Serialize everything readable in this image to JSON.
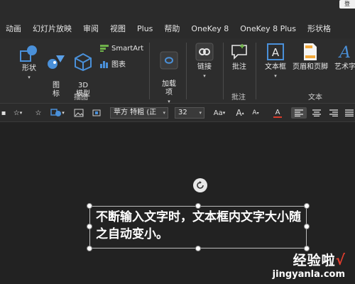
{
  "topbar": {
    "signin_label": "登"
  },
  "menu": {
    "tabs": [
      "动画",
      "幻灯片放映",
      "审阅",
      "视图",
      "Plus",
      "帮助",
      "OneKey 8",
      "OneKey 8 Plus",
      "形状格"
    ]
  },
  "ribbon": {
    "illustrations": {
      "shapes": "形状",
      "icons": "图\n标",
      "models3d": "3D\n模型",
      "smartart": "SmartArt",
      "chart": "图表",
      "group_label": "插图"
    },
    "addins": {
      "label": "加载\n项"
    },
    "links": {
      "label": "链接"
    },
    "comments": {
      "button": "批注",
      "group_label": "批注"
    },
    "text": {
      "textbox": "文本框",
      "header_footer": "页眉和页脚",
      "wordart": "艺术字",
      "group_label": "文本"
    }
  },
  "format_bar": {
    "font_name": "苹方 特粗 (正",
    "font_size": "32",
    "aa_label": "Aa",
    "grow_font": "A",
    "shrink_font": "A",
    "font_color_label": "A"
  },
  "slide": {
    "textbox_text": "不断输入文字时，文本框内文字大小随之自动变小。"
  },
  "watermark": {
    "cn": "经验啦",
    "check": "√",
    "en": "jingyanla.com"
  },
  "colors": {
    "background": "#222222",
    "ribbon": "#2d2d2d",
    "accent_blue": "#4a90d9",
    "font_color_underline": "#d83b2b"
  }
}
